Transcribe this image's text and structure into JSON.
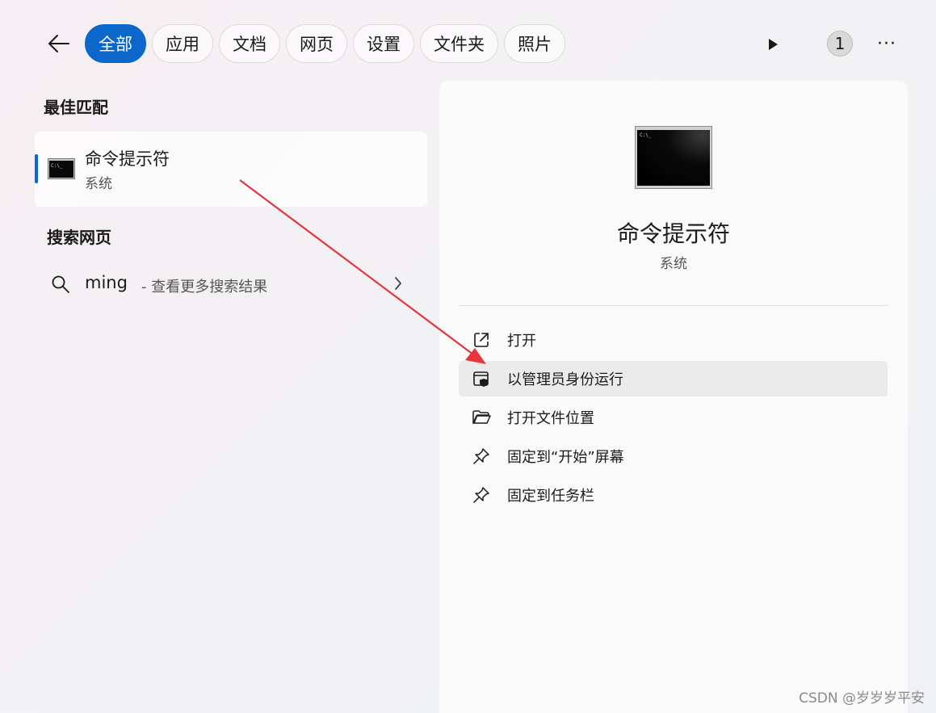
{
  "topbar": {
    "tabs": [
      {
        "label": "全部",
        "active": true
      },
      {
        "label": "应用",
        "active": false
      },
      {
        "label": "文档",
        "active": false
      },
      {
        "label": "网页",
        "active": false
      },
      {
        "label": "设置",
        "active": false
      },
      {
        "label": "文件夹",
        "active": false
      },
      {
        "label": "照片",
        "active": false
      }
    ],
    "badge_count": "1"
  },
  "left": {
    "best_match_heading": "最佳匹配",
    "best_match": {
      "name": "命令提示符",
      "type": "系统",
      "icon": "command-prompt-icon"
    },
    "web_heading": "搜索网页",
    "web_result": {
      "query": "ming",
      "hint": "- 查看更多搜索结果"
    }
  },
  "detail": {
    "title": "命令提示符",
    "subtitle": "系统",
    "actions": [
      {
        "label": "打开",
        "icon": "open-external-icon"
      },
      {
        "label": "以管理员身份运行",
        "icon": "run-as-admin-icon",
        "highlighted": true
      },
      {
        "label": "打开文件位置",
        "icon": "folder-icon"
      },
      {
        "label": "固定到“开始”屏幕",
        "icon": "pin-icon"
      },
      {
        "label": "固定到任务栏",
        "icon": "pin-icon"
      }
    ]
  },
  "colors": {
    "accent": "#0b67c9",
    "annotation_arrow": "#e8343a"
  },
  "watermark": "CSDN @岁岁岁平安"
}
